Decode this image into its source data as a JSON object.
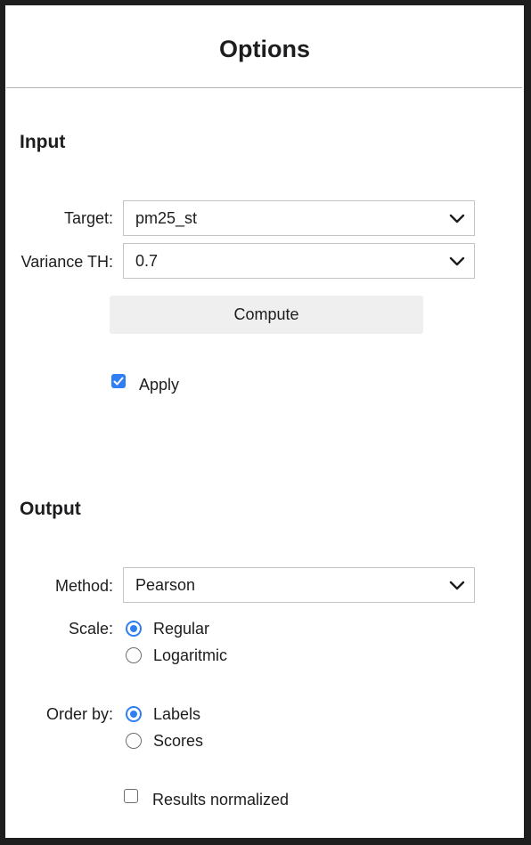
{
  "title": "Options",
  "input": {
    "heading": "Input",
    "target_label": "Target:",
    "target_value": "pm25_st",
    "variance_label": "Variance TH:",
    "variance_value": "0.7",
    "compute_label": "Compute",
    "apply_label": "Apply",
    "apply_checked": true
  },
  "output": {
    "heading": "Output",
    "method_label": "Method:",
    "method_value": "Pearson",
    "scale_label": "Scale:",
    "scale_options": [
      {
        "label": "Regular",
        "selected": true
      },
      {
        "label": "Logaritmic",
        "selected": false
      }
    ],
    "order_label": "Order by:",
    "order_options": [
      {
        "label": "Labels",
        "selected": true
      },
      {
        "label": "Scores",
        "selected": false
      }
    ],
    "normalized_label": "Results normalized",
    "normalized_checked": false
  },
  "colors": {
    "accent": "#2f7ef3",
    "button_bg": "#efefef",
    "frame": "#1e1e1e"
  },
  "icons": {
    "select_chevron": "chevron-down-icon",
    "checkbox_check": "checkmark-icon"
  }
}
